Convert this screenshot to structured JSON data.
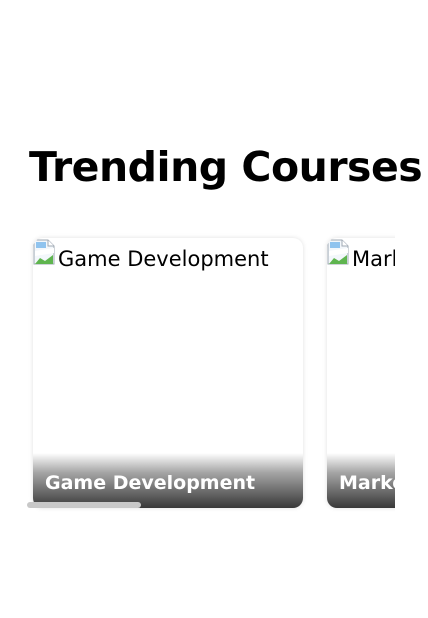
{
  "section": {
    "title": "Trending Courses"
  },
  "courses": [
    {
      "image_alt": "Game Development",
      "title": "Game Development"
    },
    {
      "image_alt": "Marketing",
      "title": "Marketing"
    }
  ],
  "icons": {
    "broken_image": "broken-image-icon"
  },
  "colors": {
    "title": "#000000",
    "card_title": "#ffffff",
    "scrollbar_thumb": "#c8c8c8"
  },
  "scroll": {
    "thumb_fraction": 0.31
  }
}
